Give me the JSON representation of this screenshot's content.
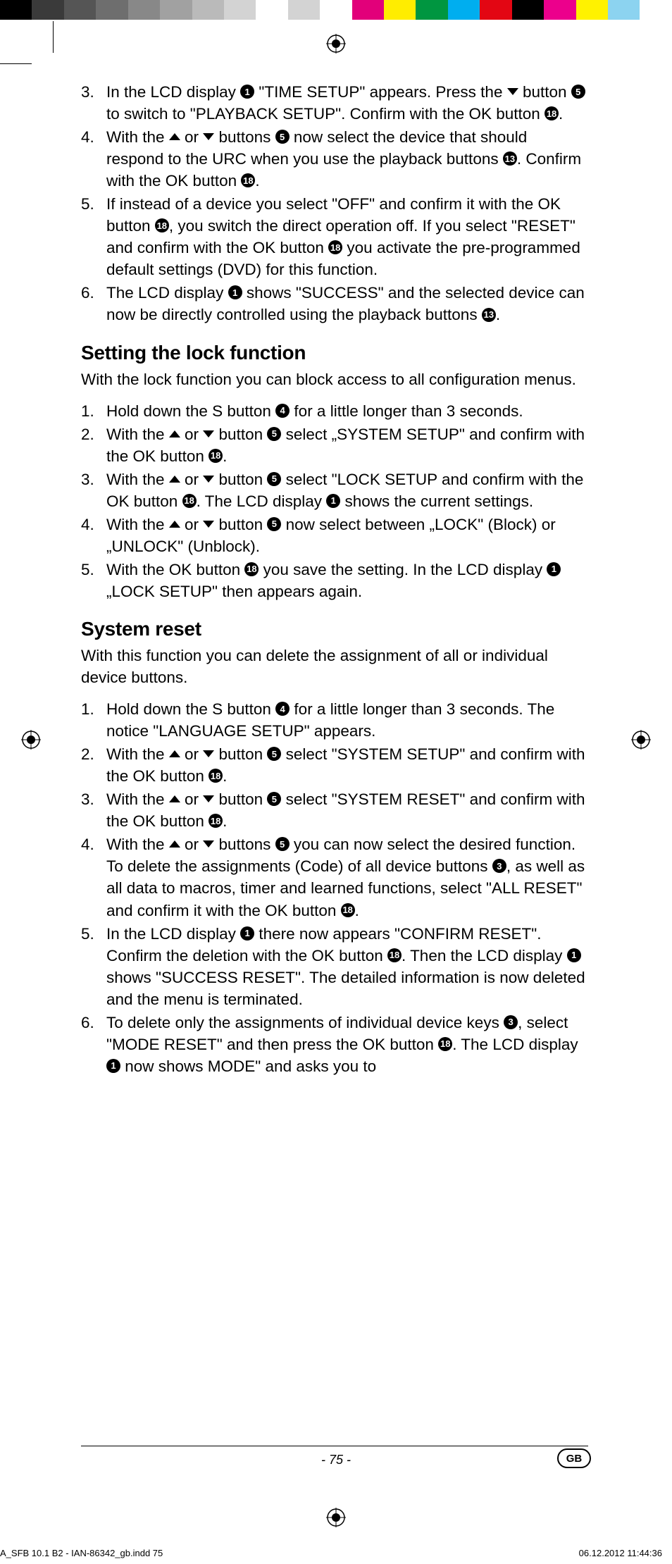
{
  "colorbar": [
    "#000000",
    "#3a3a3a",
    "#555555",
    "#6e6e6e",
    "#888888",
    "#a1a1a1",
    "#bababa",
    "#d3d3d3",
    "#ffffff",
    "#d3d3d3",
    "#ffffff",
    "#e2007a",
    "#ffed00",
    "#009640",
    "#00aeef",
    "#e30613",
    "#000000",
    "#ec008c",
    "#fff200",
    "#8cd3f0",
    "#ffffff"
  ],
  "listA": [
    {
      "n": "3.",
      "t": "In the LCD display {1} \"TIME SETUP\" appears. Press the {down} button {5} to switch to \"PLAYBACK SETUP\". Confirm with the OK button {18}."
    },
    {
      "n": "4.",
      "t": "With the {up} or {down} buttons {5} now select the device that should respond to the URC when you use the playback buttons {13}. Confirm with the OK button {18}."
    },
    {
      "n": "5.",
      "t": "If instead of a device you select \"OFF\" and confirm it with the OK button {18}, you switch the direct operation off. If you select \"RESET\" and confirm with the OK button {18} you activate the pre-programmed default settings (DVD) for this function."
    },
    {
      "n": "6.",
      "t": "The LCD display {1} shows \"SUCCESS\" and the selected device can now be directly controlled using the playback buttons {13}."
    }
  ],
  "h1": "Setting the lock function",
  "p1": "With the lock function you can block access to all configuration menus.",
  "listB": [
    {
      "n": "1.",
      "t": "Hold down the S button {4} for a little longer than 3 seconds."
    },
    {
      "n": "2.",
      "t": "With the {up} or {down} button {5} select „SYSTEM SETUP\" and confirm with the OK button {18}."
    },
    {
      "n": "3.",
      "t": "With the {up} or {down} button {5} select \"LOCK SETUP and confirm with the OK button {18}. The LCD display {1} shows the current settings."
    },
    {
      "n": "4.",
      "t": "With the {up} or {down} button {5} now select between „LOCK\" (Block) or „UNLOCK\" (Unblock)."
    },
    {
      "n": "5.",
      "t": "With the OK button {18} you save the setting. In the LCD display {1} „LOCK SETUP\" then appears again."
    }
  ],
  "h2": "System reset",
  "p2": "With this function you can delete the assignment of all or individual device buttons.",
  "listC": [
    {
      "n": "1.",
      "t": "Hold down the S button {4} for a little longer than 3 seconds. The notice \"LANGUAGE SETUP\" appears."
    },
    {
      "n": "2.",
      "t": "With the {up} or {down} button {5} select \"SYSTEM SETUP\" and confirm with the OK button {18}."
    },
    {
      "n": "3.",
      "t": "With the {up} or {down} button {5} select \"SYSTEM RESET\" and confirm with the OK button {18}."
    },
    {
      "n": "4.",
      "t": "With the {up} or {down} buttons {5} you can now select the desired function. To delete the assignments (Code) of all device buttons {3}, as well as all data to macros, timer and learned functions, select \"ALL RESET\" and confirm it with the OK button {18}."
    },
    {
      "n": "5.",
      "t": "In the LCD display {1} there now appears \"CONFIRM RESET\". Confirm the deletion with the OK button {18}. Then the LCD display {1} shows \"SUCCESS RESET\". The detailed information is now deleted and the menu is terminated."
    },
    {
      "n": "6.",
      "t": "To delete only the assignments of individual device keys {3}, select \"MODE RESET\" and then press the OK button {18}. The LCD display {1} now shows MODE\" and asks you to"
    }
  ],
  "pageNum": "- 75 -",
  "gb": "GB",
  "inddLeft": "A_SFB 10.1 B2 - IAN-86342_gb.indd   75",
  "inddRight": "06.12.2012   11:44:36"
}
